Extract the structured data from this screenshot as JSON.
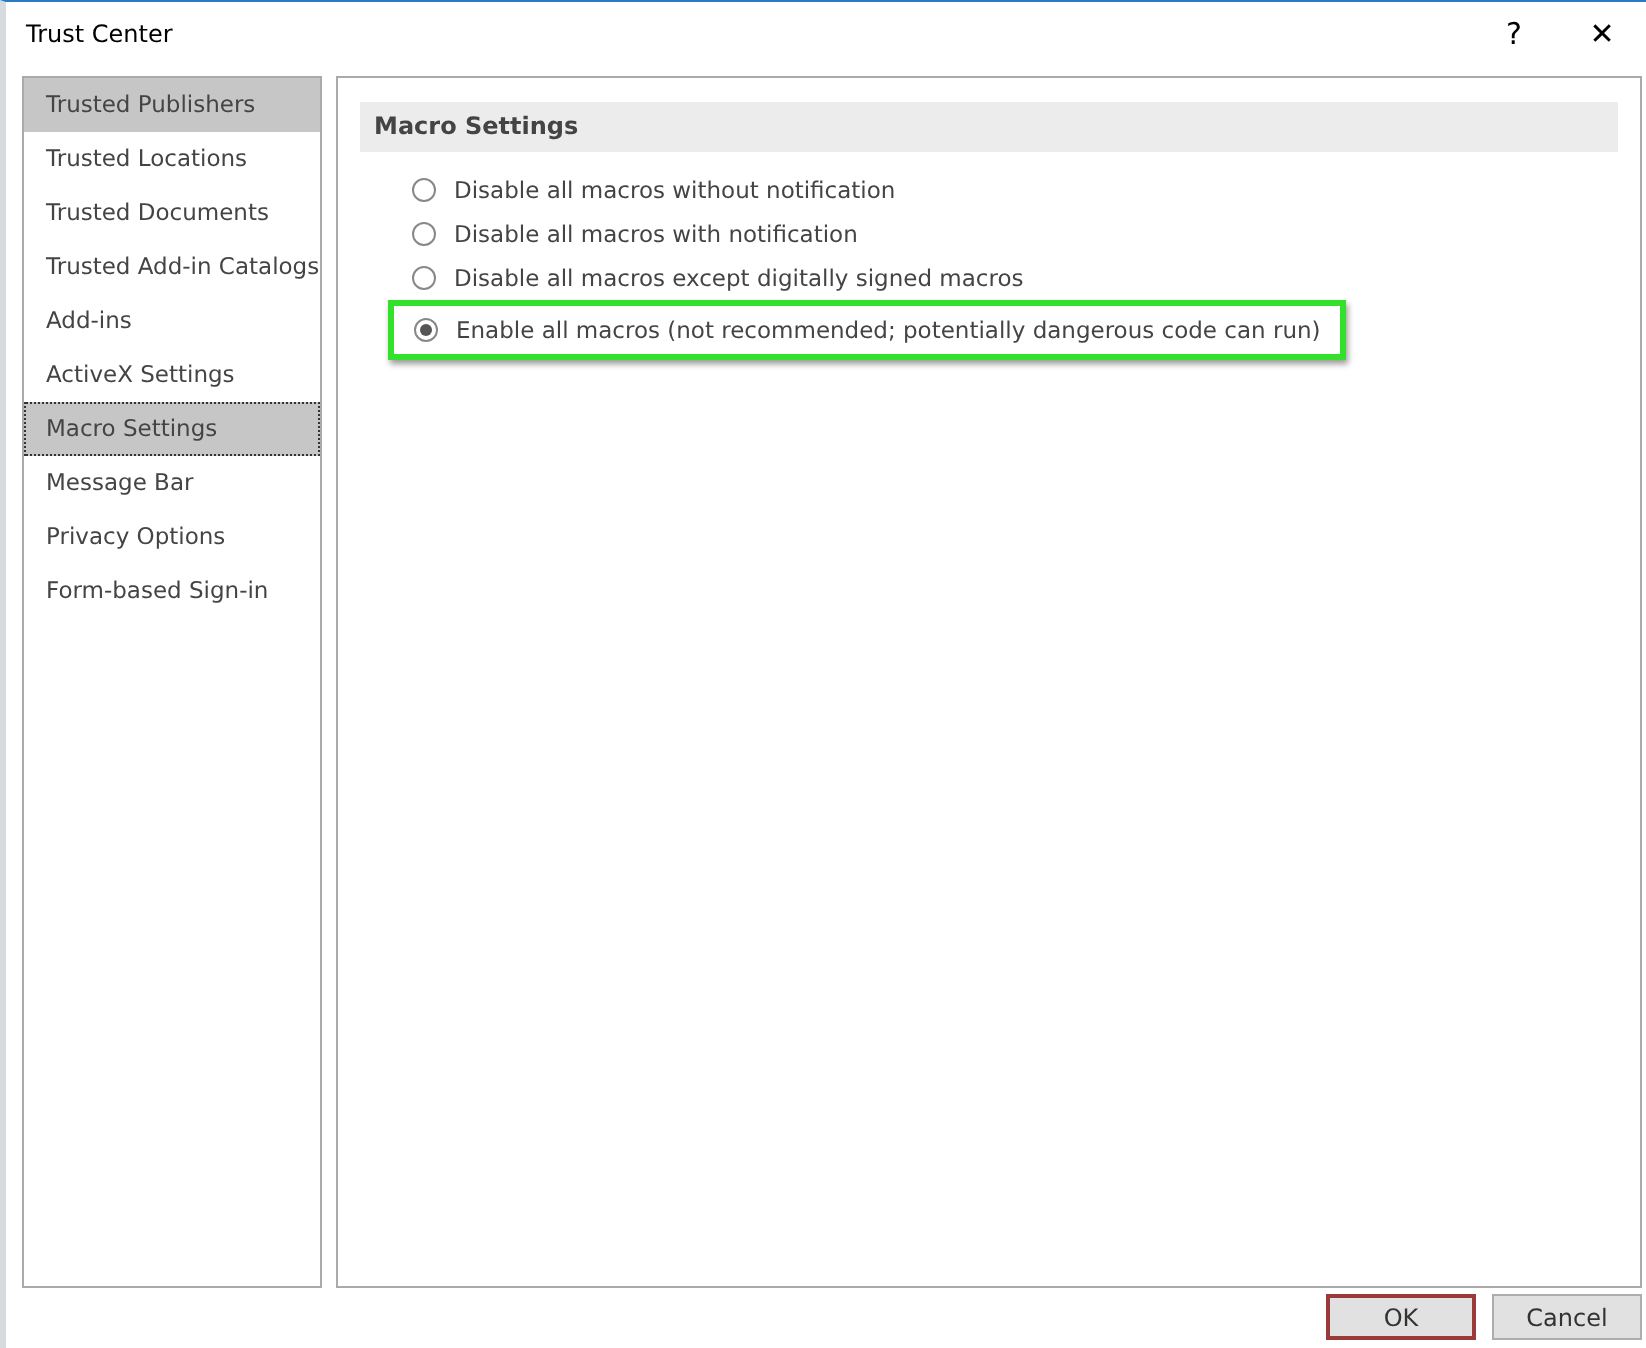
{
  "window": {
    "title": "Trust Center",
    "help_button": "?",
    "close_button": "✕"
  },
  "sidebar": {
    "items": [
      {
        "label": "Trusted Publishers",
        "selected": false,
        "highlighted": true
      },
      {
        "label": "Trusted Locations",
        "selected": false,
        "highlighted": false
      },
      {
        "label": "Trusted Documents",
        "selected": false,
        "highlighted": false
      },
      {
        "label": "Trusted Add-in Catalogs",
        "selected": false,
        "highlighted": false
      },
      {
        "label": "Add-ins",
        "selected": false,
        "highlighted": false
      },
      {
        "label": "ActiveX Settings",
        "selected": false,
        "highlighted": false
      },
      {
        "label": "Macro Settings",
        "selected": true,
        "highlighted": false
      },
      {
        "label": "Message Bar",
        "selected": false,
        "highlighted": false
      },
      {
        "label": "Privacy Options",
        "selected": false,
        "highlighted": false
      },
      {
        "label": "Form-based Sign-in",
        "selected": false,
        "highlighted": false
      }
    ]
  },
  "section": {
    "heading": "Macro Settings",
    "options": [
      {
        "label": "Disable all macros without notification",
        "selected": false,
        "highlighted": false
      },
      {
        "label": "Disable all macros with notification",
        "selected": false,
        "highlighted": false
      },
      {
        "label": "Disable all macros except digitally signed macros",
        "selected": false,
        "highlighted": false
      },
      {
        "label": "Enable all macros (not recommended; potentially dangerous code can run)",
        "selected": true,
        "highlighted": true
      }
    ]
  },
  "buttons": [
    {
      "label": "OK",
      "default": true
    },
    {
      "label": "Cancel",
      "default": false
    }
  ]
}
